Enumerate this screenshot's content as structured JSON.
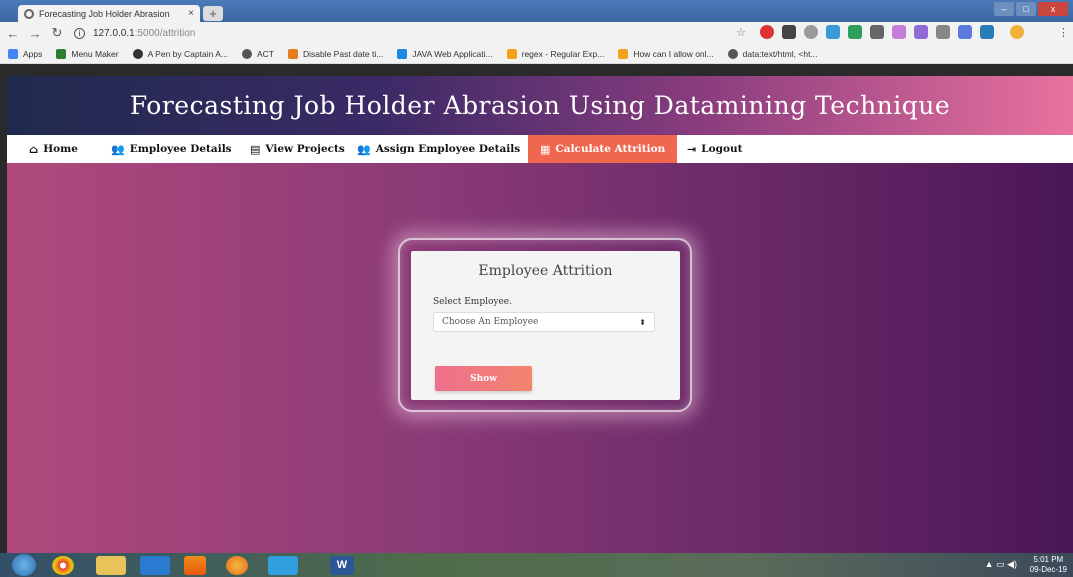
{
  "browser": {
    "tab_title": "Forecasting Job Holder Abrasion",
    "tab_close": "×",
    "new_tab": "+",
    "url_host": "127.0.0.1",
    "url_path": ":5000/attrition",
    "win_minimize": "–",
    "win_maximize": "□",
    "win_close": "x",
    "bookmarks": [
      {
        "label": "Apps",
        "color": "#4285f4"
      },
      {
        "label": "Menu Maker",
        "color": "#2e7d32"
      },
      {
        "label": "A Pen by Captain A...",
        "color": "#333333"
      },
      {
        "label": "ACT",
        "color": "#555555"
      },
      {
        "label": "Disable Past date ti...",
        "color": "#e57c1f"
      },
      {
        "label": "JAVA Web Applicati...",
        "color": "#1e88e5"
      },
      {
        "label": "regex - Regular Exp...",
        "color": "#f4a21d"
      },
      {
        "label": "How can I allow onl...",
        "color": "#f4a21d"
      },
      {
        "label": "data:text/html, <ht...",
        "color": "#555555"
      }
    ]
  },
  "page": {
    "title": "Forecasting Job Holder Abrasion Using Datamining Technique",
    "nav": [
      {
        "label": "Home",
        "icon": "home-icon"
      },
      {
        "label": "Employee Details",
        "icon": "users-icon"
      },
      {
        "label": "View Projects",
        "icon": "file-icon"
      },
      {
        "label": "Assign Employee Details",
        "icon": "users-icon"
      },
      {
        "label": "Calculate Attrition",
        "icon": "calculator-icon",
        "active": true
      },
      {
        "label": "Logout",
        "icon": "sign-out-icon"
      }
    ],
    "form": {
      "heading": "Employee Attrition",
      "select_label": "Select Employee.",
      "select_value": "Choose An Employee",
      "button_label": "Show"
    }
  },
  "taskbar": {
    "time": "5:01 PM",
    "date": "09-Dec-19"
  },
  "colors": {
    "active_nav": "#f0674f",
    "button_start": "#ef6f8e",
    "button_end": "#f2856d"
  }
}
